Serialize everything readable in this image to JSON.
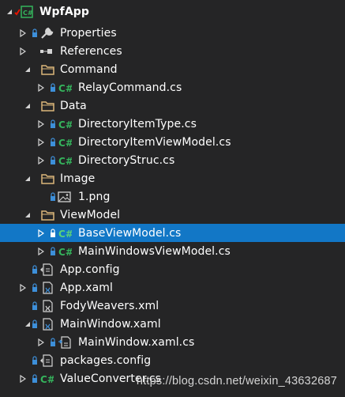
{
  "project": {
    "name": "WpfApp"
  },
  "items": [
    {
      "label": "Properties"
    },
    {
      "label": "References"
    },
    {
      "label": "Command"
    },
    {
      "label": "RelayCommand.cs"
    },
    {
      "label": "Data"
    },
    {
      "label": "DirectoryItemType.cs"
    },
    {
      "label": "DirectoryItemViewModel.cs"
    },
    {
      "label": "DirectoryStruc.cs"
    },
    {
      "label": "Image"
    },
    {
      "label": "1.png"
    },
    {
      "label": "ViewModel"
    },
    {
      "label": "BaseViewModel.cs"
    },
    {
      "label": "MainWindowsViewModel.cs"
    },
    {
      "label": "App.config"
    },
    {
      "label": "App.xaml"
    },
    {
      "label": "FodyWeavers.xml"
    },
    {
      "label": "MainWindow.xaml"
    },
    {
      "label": "MainWindow.xaml.cs"
    },
    {
      "label": "packages.config"
    },
    {
      "label": "ValueConverter.cs"
    }
  ],
  "watermark": "https://blog.csdn.net/weixin_43632687",
  "colors": {
    "background": "#252526",
    "selection": "#1277c6",
    "csharp_icon": "#35b35c",
    "folder": "#dcb67a",
    "lock": "#3d8fd9",
    "git_check": "#e51400"
  }
}
